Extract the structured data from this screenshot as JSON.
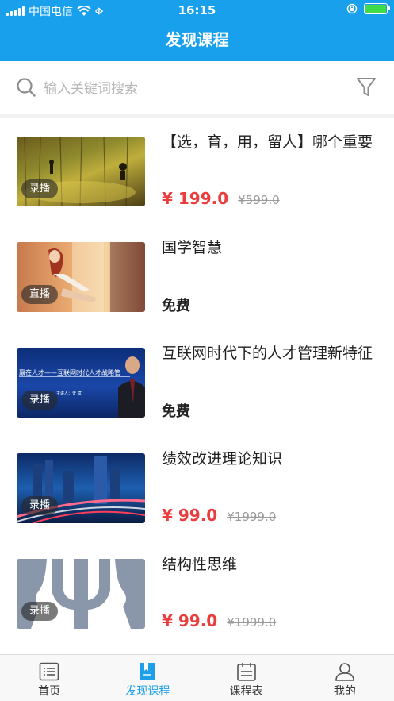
{
  "status_bar": {
    "carrier": "中国电信",
    "time": "16:15"
  },
  "nav": {
    "title": "发现课程"
  },
  "search": {
    "placeholder": "输入关键词搜索"
  },
  "courses": [
    {
      "title": "【选，育，用，留人】哪个重要",
      "badge": "录播",
      "price": "¥ 199.0",
      "original_price": "¥599.0",
      "free": ""
    },
    {
      "title": "国学智慧",
      "badge": "直播",
      "price": "",
      "original_price": "",
      "free": "免费"
    },
    {
      "title": "互联网时代下的人才管理新特征",
      "badge": "录播",
      "price": "",
      "original_price": "",
      "free": "免费",
      "thumb_text": {
        "headline": "赢在人才——互联网时代人才战略管",
        "speaker": "主讲人：史 斌"
      }
    },
    {
      "title": "绩效改进理论知识",
      "badge": "录播",
      "price": "¥ 99.0",
      "original_price": "¥1999.0",
      "free": ""
    },
    {
      "title": "结构性思维",
      "badge": "录播",
      "price": "¥ 99.0",
      "original_price": "¥1999.0",
      "free": ""
    }
  ],
  "tabs": [
    {
      "label": "首页",
      "icon": "home-list-icon",
      "active": false
    },
    {
      "label": "发现课程",
      "icon": "discover-book-icon",
      "active": true
    },
    {
      "label": "课程表",
      "icon": "schedule-icon",
      "active": false
    },
    {
      "label": "我的",
      "icon": "profile-icon",
      "active": false
    }
  ],
  "colors": {
    "brand": "#19a0ec",
    "price": "#ea3d3d",
    "tab_active": "#1d9fe9"
  }
}
